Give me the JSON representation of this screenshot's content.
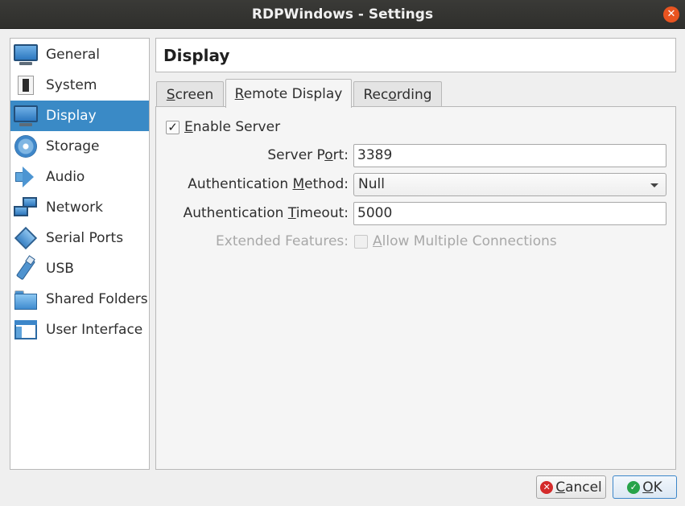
{
  "window": {
    "title": "RDPWindows - Settings",
    "close_glyph": "✕"
  },
  "sidebar": {
    "items": [
      {
        "label": "General",
        "icon": "monitor-icon"
      },
      {
        "label": "System",
        "icon": "chip-icon"
      },
      {
        "label": "Display",
        "icon": "monitor-icon",
        "selected": true
      },
      {
        "label": "Storage",
        "icon": "disk-icon"
      },
      {
        "label": "Audio",
        "icon": "speaker-icon"
      },
      {
        "label": "Network",
        "icon": "network-icon"
      },
      {
        "label": "Serial Ports",
        "icon": "serial-port-icon"
      },
      {
        "label": "USB",
        "icon": "usb-icon"
      },
      {
        "label": "Shared Folders",
        "icon": "folder-icon"
      },
      {
        "label": "User Interface",
        "icon": "user-interface-icon"
      }
    ]
  },
  "page": {
    "title": "Display"
  },
  "tabs": [
    {
      "label": "Screen",
      "mnemonic_prefix": "",
      "mnemonic": "S",
      "rest": "creen"
    },
    {
      "label": "Remote Display",
      "mnemonic_prefix": "",
      "mnemonic": "R",
      "rest": "emote Display",
      "active": true
    },
    {
      "label": "Recording",
      "mnemonic_prefix": "Rec",
      "mnemonic": "o",
      "rest": "rding"
    }
  ],
  "remote_display": {
    "enable_server": {
      "checked": true,
      "check_glyph": "✓",
      "mnemonic": "E",
      "rest": "nable Server"
    },
    "server_port": {
      "label_prefix": "Server P",
      "label_mnemonic": "o",
      "label_rest": "rt:",
      "value": "3389"
    },
    "auth_method": {
      "label_prefix": "Authentication ",
      "label_mnemonic": "M",
      "label_rest": "ethod:",
      "value": "Null"
    },
    "auth_timeout": {
      "label_prefix": "Authentication ",
      "label_mnemonic": "T",
      "label_rest": "imeout:",
      "value": "5000"
    },
    "extended_features": {
      "label": "Extended Features:",
      "option_prefix": "",
      "option_mnemonic": "A",
      "option_rest": "llow Multiple Connections",
      "checked": false,
      "enabled": false
    }
  },
  "buttons": {
    "cancel": {
      "mnemonic": "C",
      "rest": "ancel",
      "icon": "cancel-icon",
      "glyph": "✕"
    },
    "ok": {
      "mnemonic": "O",
      "rest": "K",
      "icon": "ok-icon",
      "glyph": "✓"
    }
  },
  "colors": {
    "selection": "#3a8ac6",
    "cancel_icon": "#d42b2b",
    "ok_icon": "#27a34a",
    "close_button": "#e95420"
  }
}
